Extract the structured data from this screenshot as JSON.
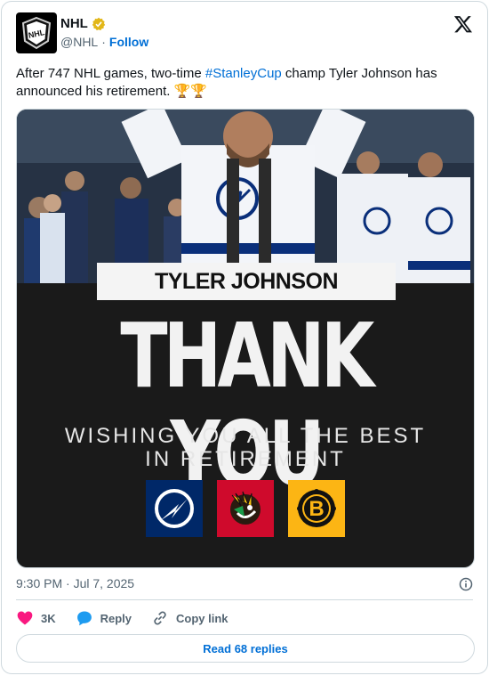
{
  "account": {
    "name": "NHL",
    "handle": "@NHL",
    "separator": "·",
    "follow_label": "Follow"
  },
  "tweet": {
    "text_before": "After 747 NHL games, two-time ",
    "hashtag": "#StanleyCup",
    "text_after": " champ Tyler Johnson has announced his retirement. 🏆🏆"
  },
  "media": {
    "name_plate": "TYLER JOHNSON",
    "headline": "THANK YOU",
    "subline_1": "WISHING YOU ALL THE BEST",
    "subline_2": "IN RETIREMENT",
    "team_logos": [
      "tampa-bay-lightning-logo",
      "chicago-blackhawks-logo",
      "boston-bruins-logo"
    ]
  },
  "meta": {
    "timestamp": "9:30 PM · Jul 7, 2025"
  },
  "actions": {
    "likes": "3K",
    "reply_label": "Reply",
    "copy_label": "Copy link"
  },
  "footer": {
    "read_replies": "Read 68 replies"
  },
  "colors": {
    "accent": "#006fd6",
    "like": "#f91880",
    "verified": "#e2b719",
    "lightning_blue": "#002868",
    "blackhawks_red": "#cf0a2c",
    "bruins_gold": "#fcb514"
  }
}
